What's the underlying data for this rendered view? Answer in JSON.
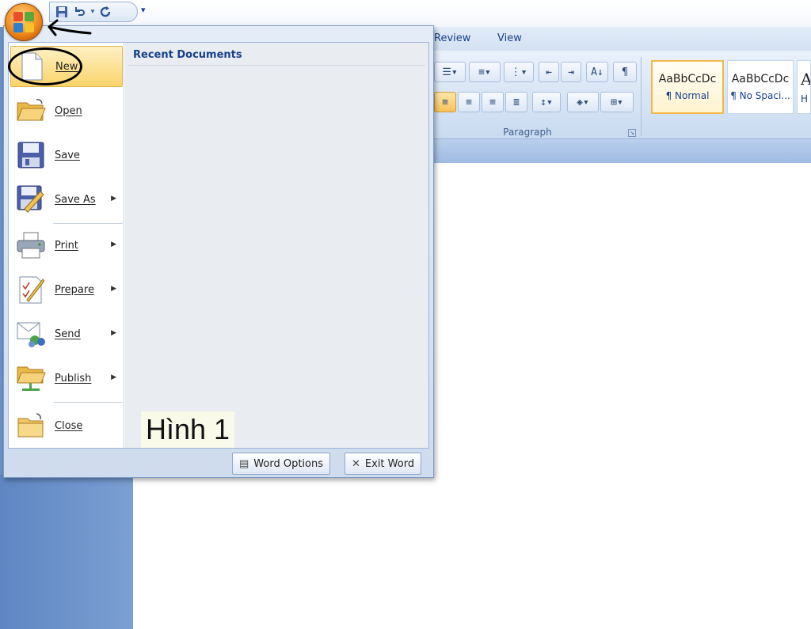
{
  "quick_access": {
    "save_icon": "save-icon",
    "undo_icon": "undo-icon",
    "redo_icon": "redo-icon",
    "more": "▾"
  },
  "tabs": [
    {
      "label": "Review"
    },
    {
      "label": "View"
    }
  ],
  "ribbon": {
    "paragraph_group_label": "Paragraph",
    "styles": [
      {
        "sample": "AaBbCcDc",
        "name": "¶ Normal",
        "selected": true
      },
      {
        "sample": "AaBbCcDc",
        "name": "¶ No Spaci..."
      },
      {
        "sample": "A",
        "name": "H"
      }
    ]
  },
  "office_menu": {
    "recent_title": "Recent Documents",
    "items": [
      {
        "label": "New",
        "icon": "new-document-icon",
        "submenu": false,
        "highlighted": true
      },
      {
        "label": "Open",
        "icon": "open-folder-icon",
        "submenu": false
      },
      {
        "label": "Save",
        "icon": "save-icon",
        "submenu": false
      },
      {
        "label": "Save As",
        "icon": "save-as-icon",
        "submenu": true
      },
      {
        "label": "Print",
        "icon": "printer-icon",
        "submenu": true
      },
      {
        "label": "Prepare",
        "icon": "prepare-icon",
        "submenu": true
      },
      {
        "label": "Send",
        "icon": "send-icon",
        "submenu": true
      },
      {
        "label": "Publish",
        "icon": "publish-icon",
        "submenu": true
      },
      {
        "label": "Close",
        "icon": "close-folder-icon",
        "submenu": false
      }
    ],
    "word_options": "Word Options",
    "exit_word": "Exit Word"
  },
  "annotation": {
    "caption": "Hình 1"
  },
  "colors": {
    "accent": "#15428b",
    "highlight": "#fbd46a",
    "office_orange": "#f08a1c"
  }
}
